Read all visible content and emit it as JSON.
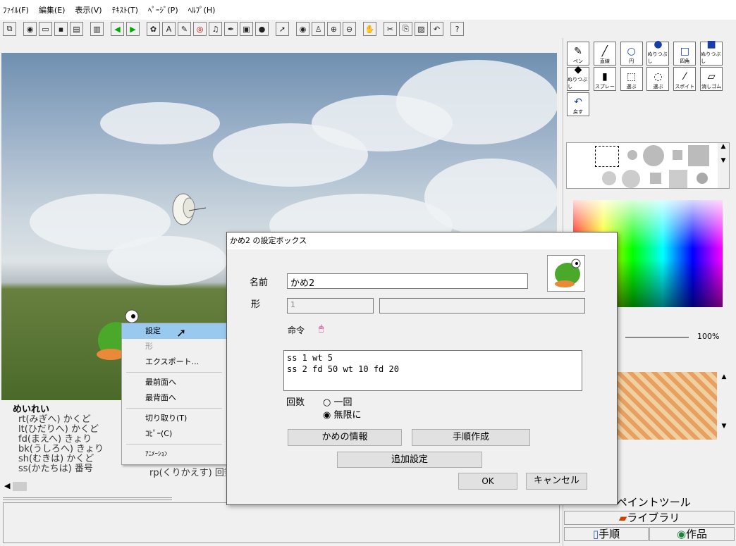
{
  "menu": [
    "ﾌｧｲﾙ(F)",
    "編集(E)",
    "表示(V)",
    "ﾃｷｽﾄ(T)",
    "ﾍﾟｰｼﾞ(P)",
    "ﾍﾙﾌﾟ(H)"
  ],
  "toolbar_help": "?",
  "cmds": {
    "title": "めいれい",
    "l1": "rt(みぎへ) かくど",
    "l2": "lt(ひだりへ) かくど",
    "l3": "fd(まえへ) きょり",
    "l4": "bk(うしろへ) きょり",
    "l5": "sh(むきは) かくど",
    "l6": "ss(かたちは) 番号",
    "l7": "rp(くりかえす) 回数"
  },
  "paint": {
    "pen": "ペン",
    "line": "直線",
    "circle": "円",
    "fill_circle": "ぬりつぶし",
    "rect": "四角",
    "fill_rect": "ぬりつぶし",
    "fill": "ぬりつぶし",
    "spray": "スプレー",
    "select": "選ぶ",
    "lasso": "選ぶ",
    "dropper": "スポイト",
    "eraser": "消しゴム",
    "undo": "戻す",
    "zoom": "100%"
  },
  "tabs": {
    "paint": "ペイントツール",
    "library": "ライブラリ",
    "procedure": "手順",
    "work": "作品"
  },
  "ctx": {
    "settings": "設定",
    "shape": "形",
    "export": "エクスポート...",
    "front": "最前面へ",
    "back": "最背面へ",
    "cut": "切り取り(T)",
    "copy": "ｺﾋﾟｰ(C)",
    "anim": "ｱﾆﾒｰｼｮﾝ"
  },
  "dialog": {
    "title": "かめ2 の設定ボックス",
    "name_label": "名前",
    "name_value": "かめ2",
    "shape_label": "形",
    "shape_value": "1",
    "cmd_label": "命令",
    "line1": "ss 1 wt 5",
    "line2": "ss 2 fd 50 wt 10 fd 20",
    "count_label": "回数",
    "once": "一回",
    "infinite": "無限に",
    "info_btn": "かめの情報",
    "proc_btn": "手順作成",
    "extra_btn": "追加設定",
    "ok": "OK",
    "cancel": "キャンセル"
  }
}
